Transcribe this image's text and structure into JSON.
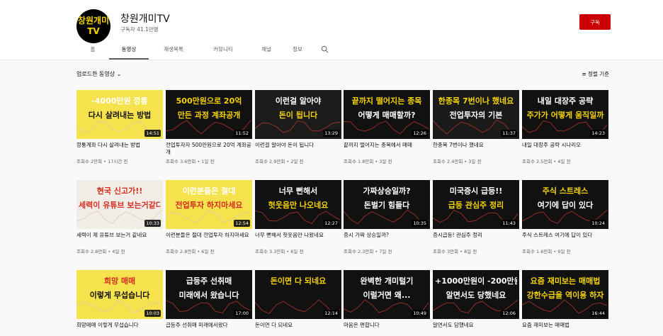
{
  "channel": {
    "avatar_line1": "창원개미",
    "avatar_line2": "TV",
    "name": "창원개미TV",
    "subscribers": "구독자 41.1만명",
    "subscribe_label": "구독"
  },
  "tabs": [
    "홈",
    "동영상",
    "재생목록",
    "커뮤니티",
    "채널",
    "정보"
  ],
  "active_tab": 1,
  "filter": {
    "uploads_label": "업로드한 동영상",
    "sort_label": "정렬 기준"
  },
  "colors": {
    "brand_red": "#cc0000",
    "yellow": "#f5d400"
  },
  "videos": [
    {
      "thumb_line1": "-4000만원 깡통",
      "thumb_line2": "다시 살려내는 방법",
      "duration": "14:51",
      "title": "깡통계좌 다시 살려내는 방법",
      "meta": "조회수 2만회 • 17시간 전",
      "bg": "#f6e24c",
      "c1": "#fff",
      "c2": "#111"
    },
    {
      "thumb_line1": "500만원으로 20억",
      "thumb_line2": "만든 과정 계좌공개",
      "duration": "11:52",
      "title": "전업투자자 500만원으로 20억 계좌공개",
      "meta": "조회수 3.6만회 • 1일 전",
      "bg": "#111",
      "c1": "#f5d400",
      "c2": "#f5d400"
    },
    {
      "thumb_line1": "이런걸 알아야",
      "thumb_line2": "돈이 됩니다",
      "duration": "13:29",
      "title": "이런걸 알아야 돈이 됩니다",
      "meta": "조회수 2.9만회 • 2일 전",
      "bg": "#1c1c1c",
      "c1": "#fff",
      "c2": "#f5d400"
    },
    {
      "thumb_line1": "끝까지 떨어지는 종목",
      "thumb_line2": "어떻게 매매할까?",
      "duration": "12:26",
      "title": "끝까지 떨어지는 종목에서 매매",
      "meta": "조회수 1.8만회 • 3일 전",
      "bg": "#111",
      "c1": "#f5d400",
      "c2": "#fff"
    },
    {
      "thumb_line1": "한종목 7번이나 했네요",
      "thumb_line2": "전업투자의 기본",
      "duration": "11:37",
      "title": "한종목 7번이나 했네요",
      "meta": "조회수 2.4만회 • 3일 전",
      "bg": "#1a1a1a",
      "c1": "#f5d400",
      "c2": "#fff"
    },
    {
      "thumb_line1": "내일 대장주 공략",
      "thumb_line2": "주가가 어떻게 움직일까",
      "duration": "14:23",
      "title": "내일 대장주 공략 시나리오",
      "meta": "조회수 2.5만회 • 4일 전",
      "bg": "#111",
      "c1": "#fff",
      "c2": "#f5d400"
    },
    {
      "thumb_line1": "현국 신고가!!",
      "thumb_line2": "세력이 유튜브 보는거같다",
      "duration": "10:33",
      "title": "세력이 제 유튜브 보는거 같네요",
      "meta": "조회수 2.8만회 • 4일 전",
      "bg": "#f2ede6",
      "c1": "#d62b1f",
      "c2": "#d62b1f"
    },
    {
      "thumb_line1": "이런분들은 절대",
      "thumb_line2": "전업투자 하지마세요",
      "duration": "12:54",
      "title": "이런분들은 절대 전업투자 하지마세요",
      "meta": "조회수 2.8만회 • 6일 전",
      "bg": "#f6e24c",
      "c1": "#fff",
      "c2": "#d62b1f"
    },
    {
      "thumb_line1": "너무 뻔해서",
      "thumb_line2": "헛웃음만 나오네요",
      "duration": "12:27",
      "title": "너무 뻔해서 헛웃음만 나왔네요",
      "meta": "조회수 3.3만회 • 6일 전",
      "bg": "#111",
      "c1": "#fff",
      "c2": "#f5d400"
    },
    {
      "thumb_line1": "가짜상승일까?",
      "thumb_line2": "돈벌기 힘들다",
      "duration": "10:35",
      "title": "증시 가짜 상승일까?",
      "meta": "조회수 2.3만회 • 7일 전",
      "bg": "#111",
      "c1": "#fff",
      "c2": "#fff"
    },
    {
      "thumb_line1": "미국증시 급등!!",
      "thumb_line2": "급등 관심주 정리",
      "duration": "11:43",
      "title": "증시급등! 관심주 정리",
      "meta": "조회수 3만회 • 8일 전",
      "bg": "#111",
      "c1": "#fff",
      "c2": "#f5d400"
    },
    {
      "thumb_line1": "주식 스트레스",
      "thumb_line2": "여기에 답이 있다",
      "duration": "10:24",
      "title": "주식 스트레스 여기에 답이 있다",
      "meta": "조회수 1.6만회 • 9일 전",
      "bg": "#111",
      "c1": "#f5d400",
      "c2": "#fff"
    },
    {
      "thumb_line1": "희망 매매",
      "thumb_line2": "이렇게 무섭습니다",
      "duration": "10:03",
      "title": "희망매매 이렇게 무섭습니다",
      "meta": "",
      "bg": "#f6e24c",
      "c1": "#d62b1f",
      "c2": "#111"
    },
    {
      "thumb_line1": "급등주 선취매",
      "thumb_line2": "미래에서 왔습니다",
      "duration": "17:00",
      "title": "급등주 선취매 미래에서왔다",
      "meta": "",
      "bg": "#111",
      "c1": "#fff",
      "c2": "#fff"
    },
    {
      "thumb_line1": "돈이면 다 되네요",
      "thumb_line2": "",
      "duration": "12:14",
      "title": "돈이면 다 되네요",
      "meta": "",
      "bg": "#111",
      "c1": "#f5d400",
      "c2": "#fff"
    },
    {
      "thumb_line1": "완벽한 개미털기",
      "thumb_line2": "이럴거면 왜...",
      "duration": "10:49",
      "title": "마음은 편합니다",
      "meta": "",
      "bg": "#111",
      "c1": "#fff",
      "c2": "#fff"
    },
    {
      "thumb_line1": "+1000만원이 -200만원",
      "thumb_line2": "알면서도 당했네요",
      "duration": "12:06",
      "title": "알면서도 당했네요",
      "meta": "",
      "bg": "#111",
      "c1": "#fff",
      "c2": "#fff"
    },
    {
      "thumb_line1": "요즘 재미보는 매매법",
      "thumb_line2": "강한수급을 역이용 하자",
      "duration": "16:44",
      "title": "요즘 재미보는 매매법",
      "meta": "",
      "bg": "#111",
      "c1": "#f5d400",
      "c2": "#f5d400"
    }
  ]
}
